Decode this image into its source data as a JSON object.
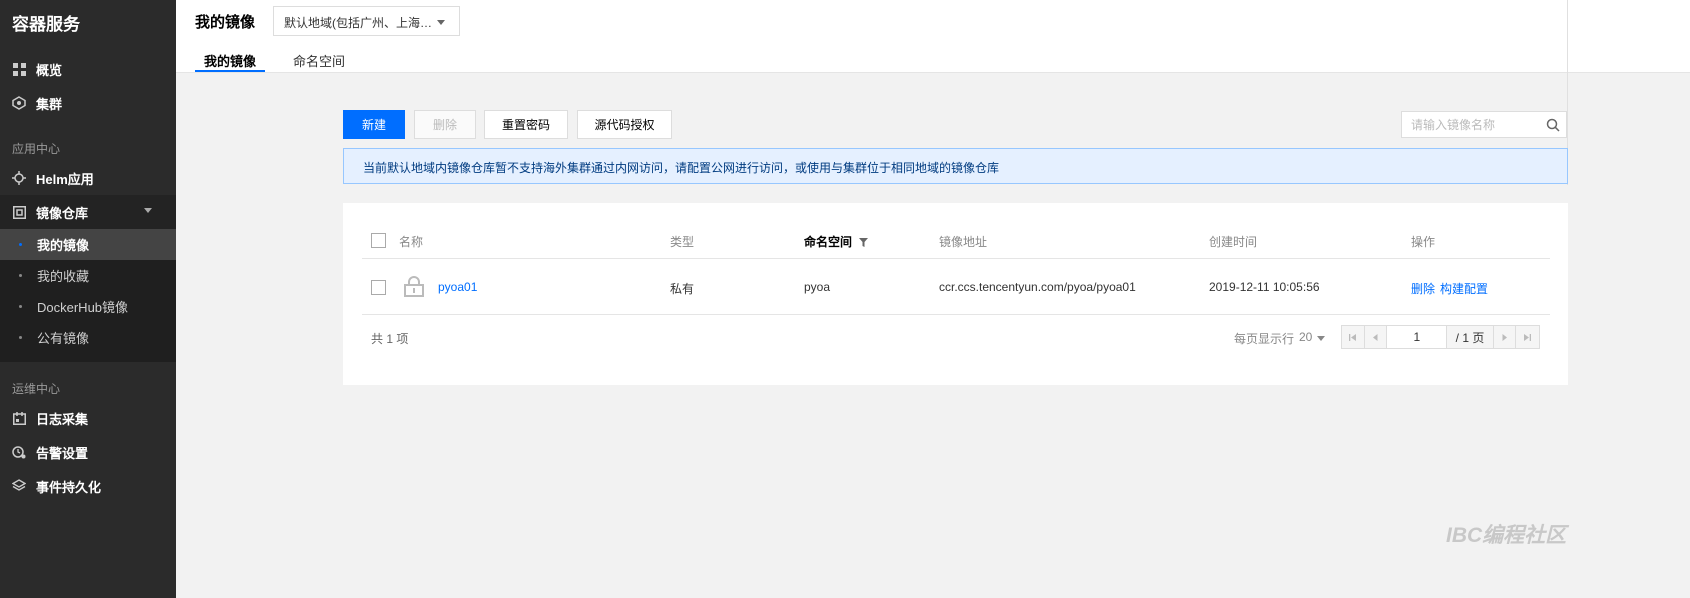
{
  "sidebar": {
    "title": "容器服务",
    "items_top": [
      {
        "label": "概览",
        "icon": "dashboard-icon"
      },
      {
        "label": "集群",
        "icon": "cluster-icon"
      }
    ],
    "section_app": "应用中心",
    "helm": "Helm应用",
    "registry": "镜像仓库",
    "registry_sub": [
      "我的镜像",
      "我的收藏",
      "DockerHub镜像",
      "公有镜像"
    ],
    "section_ops": "运维中心",
    "ops_items": [
      "日志采集",
      "告警设置",
      "事件持久化"
    ]
  },
  "header": {
    "title": "我的镜像",
    "region": "默认地域(包括广州、上海…",
    "tabs": [
      "我的镜像",
      "命名空间"
    ]
  },
  "toolbar": {
    "new": "新建",
    "delete": "删除",
    "reset_password": "重置密码",
    "source_auth": "源代码授权",
    "search_placeholder": "请输入镜像名称"
  },
  "notice": "当前默认地域内镜像仓库暂不支持海外集群通过内网访问，请配置公网进行访问，或使用与集群位于相同地域的镜像仓库",
  "table": {
    "headers": {
      "name": "名称",
      "type": "类型",
      "namespace": "命名空间",
      "address": "镜像地址",
      "created": "创建时间",
      "actions": "操作"
    },
    "rows": [
      {
        "name": "pyoa01",
        "type": "私有",
        "namespace": "pyoa",
        "address": "ccr.ccs.tencentyun.com/pyoa/pyoa01",
        "created": "2019-12-11 10:05:56",
        "action_delete": "删除",
        "action_build": "构建配置"
      }
    ],
    "total": "共 1 项",
    "per_page_label": "每页显示行",
    "per_page": "20",
    "page_input": "1",
    "page_total": "/ 1 页"
  },
  "watermark": "IBC编程社区"
}
